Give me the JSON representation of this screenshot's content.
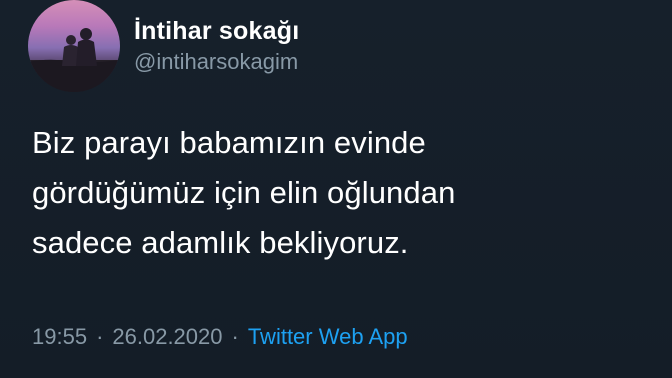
{
  "tweet": {
    "author": {
      "display_name": "İntihar sokağı",
      "handle": "@intiharsokagim"
    },
    "text_lines": [
      "Biz parayı babamızın evinde",
      "gördüğümüz için elin oğlundan",
      "sadece adamlık bekliyoruz."
    ],
    "meta": {
      "time": "19:55",
      "separator_1": "·",
      "date": "26.02.2020",
      "separator_2": "·",
      "source": "Twitter Web App"
    }
  },
  "colors": {
    "background": "#15202b",
    "text_primary": "#ffffff",
    "text_secondary": "#8899a6",
    "link": "#1da1f2"
  },
  "icons": {
    "avatar": "profile-photo-silhouettes-sunset"
  }
}
